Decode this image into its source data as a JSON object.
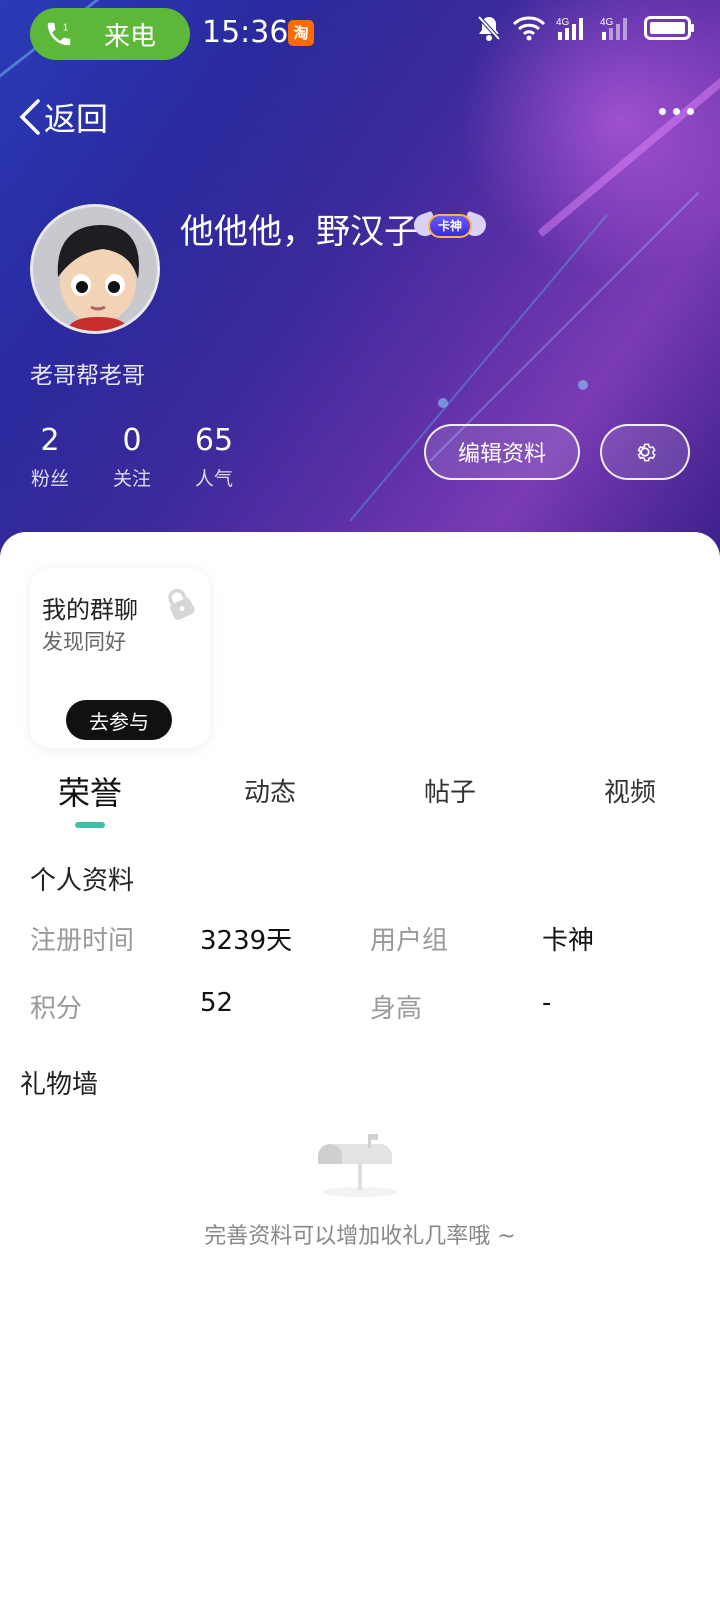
{
  "status_bar": {
    "call_label": "来电",
    "time": "15:36",
    "app_icon_text": "淘",
    "network_labels": [
      "4G",
      "4G"
    ]
  },
  "nav": {
    "back_label": "返回"
  },
  "profile": {
    "username": "他他他，野汉子",
    "badge_text": "卡神",
    "subname": "老哥帮老哥",
    "stats": [
      {
        "value": "2",
        "label": "粉丝"
      },
      {
        "value": "0",
        "label": "关注"
      },
      {
        "value": "65",
        "label": "人气"
      }
    ],
    "edit_button": "编辑资料"
  },
  "group_card": {
    "title": "我的群聊",
    "subtitle": "发现同好",
    "join_button": "去参与"
  },
  "tabs": [
    {
      "label": "荣誉",
      "active": true
    },
    {
      "label": "动态",
      "active": false
    },
    {
      "label": "帖子",
      "active": false
    },
    {
      "label": "视频",
      "active": false
    }
  ],
  "personal_info": {
    "title": "个人资料",
    "fields": [
      {
        "label": "注册时间",
        "value": "3239天"
      },
      {
        "label": "用户组",
        "value": "卡神"
      },
      {
        "label": "积分",
        "value": "52"
      },
      {
        "label": "身高",
        "value": "-"
      }
    ]
  },
  "gift_wall": {
    "title": "礼物墙",
    "empty_text": "完善资料可以增加收礼几率哦 ~"
  },
  "colors": {
    "call_pill": "#5db83a",
    "tab_indicator": "#3fbfa3",
    "join_button": "#111111"
  }
}
